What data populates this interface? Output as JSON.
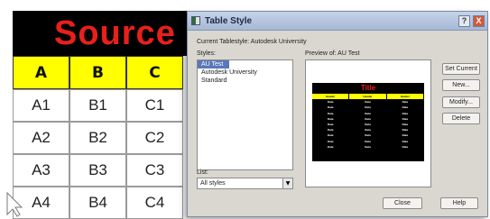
{
  "source_table": {
    "title": "Source",
    "headers": [
      "A",
      "B",
      "C"
    ],
    "rows": [
      [
        "A1",
        "B1",
        "C1"
      ],
      [
        "A2",
        "B2",
        "C2"
      ],
      [
        "A3",
        "B3",
        "C3"
      ],
      [
        "A4",
        "B4",
        "C4"
      ]
    ]
  },
  "dialog": {
    "title": "Table Style",
    "help_glyph": "?",
    "close_glyph": "X",
    "current_label": "Current Tablestyle: Autodesk University",
    "styles_label": "Styles:",
    "styles": [
      "AU Test",
      "Autodesk University",
      "Standard"
    ],
    "selected_style": "AU Test",
    "list_label": "List:",
    "list_value": "All styles",
    "preview_label": "Preview of: AU Test",
    "preview": {
      "title": "Title",
      "header": "Header",
      "data": "Data",
      "row_count": 9
    },
    "buttons": {
      "set_current": "Set Current",
      "new": "New...",
      "modify": "Modify...",
      "delete": "Delete",
      "close": "Close",
      "help": "Help"
    }
  },
  "colors": {
    "source_title": "#e8201c",
    "header_fill": "#ffff00",
    "selection": "#5a78b8"
  }
}
